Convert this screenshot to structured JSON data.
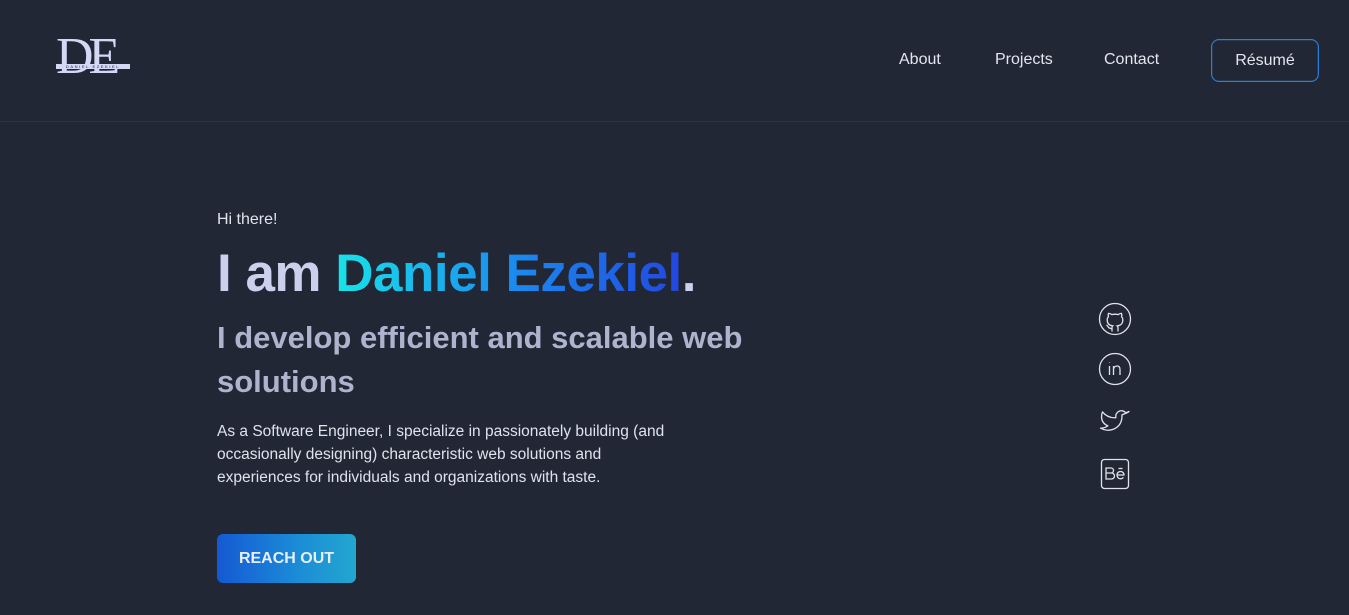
{
  "logo": {
    "letters": "DE",
    "subtitle": "DANIEL EZEKIEL"
  },
  "nav": {
    "items": [
      {
        "label": "About"
      },
      {
        "label": "Projects"
      },
      {
        "label": "Contact"
      }
    ],
    "resume_label": "Résumé"
  },
  "hero": {
    "greeting": "Hi there!",
    "headline_lead": "I am ",
    "headline_name": "Daniel Ezekiel",
    "headline_dot": ".",
    "subheadline": "I develop efficient and scalable web solutions",
    "description": "As a Software Engineer, I specialize in passionately building (and occasionally designing) characteristic web solutions and experiences for individuals and organizations with taste.",
    "cta_label": "REACH OUT"
  },
  "social": [
    {
      "icon": "github-icon"
    },
    {
      "icon": "linkedin-icon"
    },
    {
      "icon": "twitter-icon"
    },
    {
      "icon": "behance-icon"
    }
  ],
  "colors": {
    "background": "#212735",
    "accent_start": "#18e3e8",
    "accent_end": "#2247e0",
    "button_border": "#2b7fd9"
  }
}
